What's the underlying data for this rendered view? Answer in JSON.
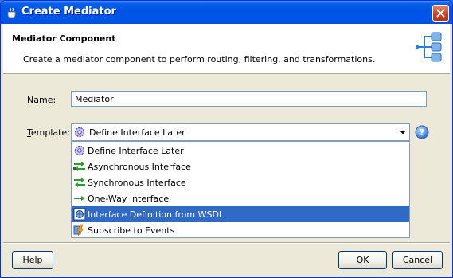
{
  "window": {
    "title": "Create Mediator"
  },
  "header": {
    "title": "Mediator Component",
    "description": "Create a mediator component to perform routing, filtering, and transformations."
  },
  "form": {
    "name_label_mnemonic": "N",
    "name_label_rest": "ame:",
    "name_value": "Mediator",
    "template_label_mnemonic": "T",
    "template_label_rest": "emplate:",
    "template_selected": "Define Interface Later"
  },
  "template_options": [
    {
      "label": "Define Interface Later",
      "icon": "gear-icon"
    },
    {
      "label": "Asynchronous Interface",
      "icon": "async-arrows-icon"
    },
    {
      "label": "Synchronous Interface",
      "icon": "sync-arrows-icon"
    },
    {
      "label": "One-Way Interface",
      "icon": "one-way-arrow-icon"
    },
    {
      "label": "Interface Definition from WSDL",
      "icon": "wsdl-icon"
    },
    {
      "label": "Subscribe to Events",
      "icon": "event-bolt-icon"
    }
  ],
  "highlighted_option_index": 4,
  "buttons": {
    "help": "Help",
    "ok": "OK",
    "cancel": "Cancel"
  },
  "colors": {
    "titlebar": "#0054e3",
    "selection": "#316ac5",
    "dialog_bg": "#ece9d8"
  }
}
